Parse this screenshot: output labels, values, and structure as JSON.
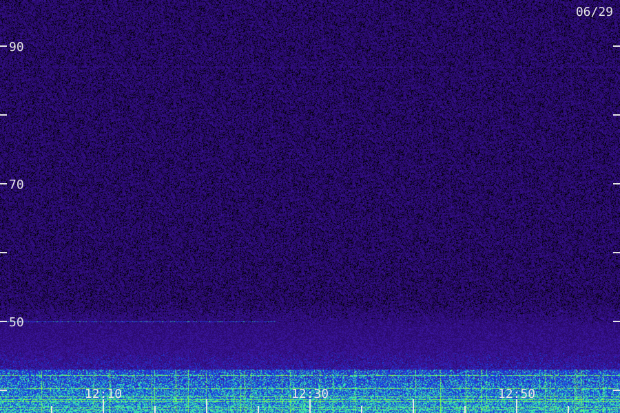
{
  "chart_data": {
    "type": "heatmap",
    "title": "06/29",
    "xlabel": "",
    "ylabel": "",
    "x_ticks": [
      "12:10",
      "12:30",
      "12:50"
    ],
    "y_ticks": [
      90,
      70,
      50
    ],
    "ylim": [
      35,
      95
    ],
    "grid": false,
    "colors": {
      "background": "#2a0a6e",
      "low": "#3a16a0",
      "mid": "#1a40e0",
      "high": "#39e6b0",
      "peak": "#8cff40",
      "text": "#e6e6e6"
    },
    "features": [
      {
        "type": "weak-hum-line",
        "y": 87
      },
      {
        "type": "hum-line",
        "y": 50
      },
      {
        "type": "strong-low-band",
        "y_range": [
          36,
          43
        ]
      }
    ]
  }
}
